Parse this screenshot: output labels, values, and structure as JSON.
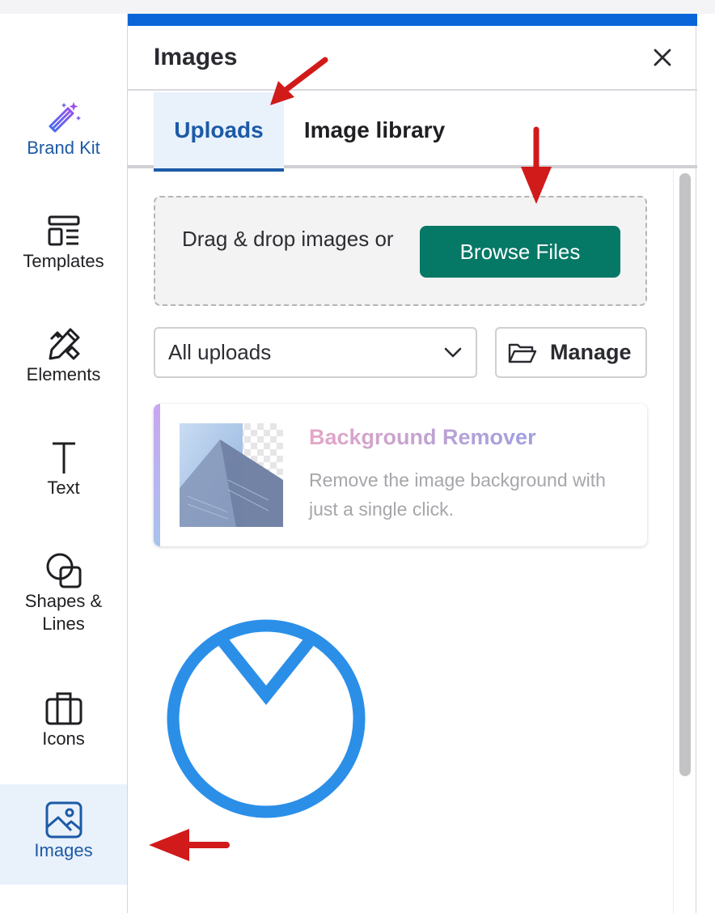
{
  "sidebar": {
    "items": [
      {
        "label": "Brand Kit",
        "icon": "magic-wand-icon"
      },
      {
        "label": "Templates",
        "icon": "templates-icon"
      },
      {
        "label": "Elements",
        "icon": "elements-icon"
      },
      {
        "label": "Text",
        "icon": "text-icon"
      },
      {
        "label": "Shapes &\nLines",
        "icon": "shapes-icon"
      },
      {
        "label": "Icons",
        "icon": "briefcase-icon"
      },
      {
        "label": "Images",
        "icon": "image-icon",
        "active": true
      }
    ]
  },
  "panel": {
    "title": "Images",
    "close_icon": "close-icon"
  },
  "tabs": [
    {
      "label": "Uploads",
      "active": true
    },
    {
      "label": "Image library",
      "active": false
    }
  ],
  "dropzone": {
    "text": "Drag & drop images or",
    "button_label": "Browse Files"
  },
  "filter": {
    "selected": "All uploads",
    "manage_label": "Manage"
  },
  "promo": {
    "title": "Background Remover",
    "description": "Remove the image background with just a single click."
  },
  "colors": {
    "accent": "#1c5aa6",
    "topbar": "#0a66d8",
    "browse_button": "#067866",
    "spinner": "#2b8fe8",
    "annotation_arrow": "#d11a1a"
  }
}
